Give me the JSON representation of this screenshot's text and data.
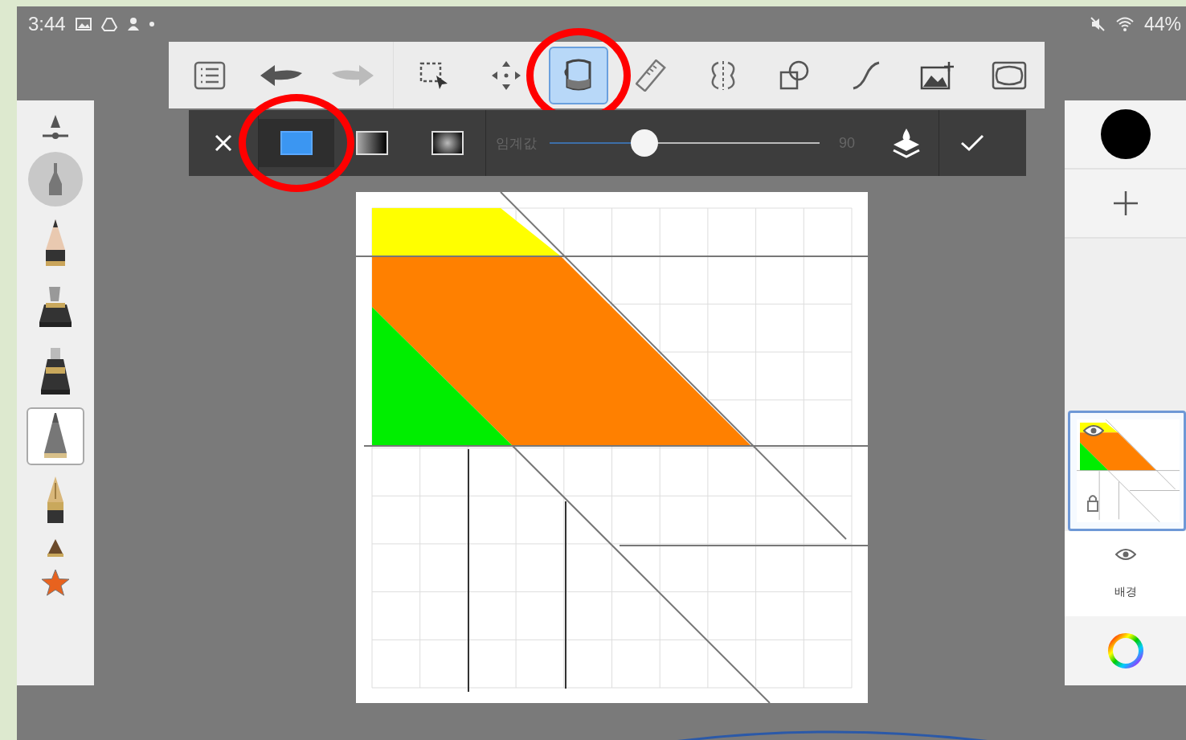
{
  "status_bar": {
    "time": "3:44",
    "battery": "44%"
  },
  "toolbar": {
    "tools": [
      {
        "kind": "list",
        "selected": false,
        "circled": false
      },
      {
        "kind": "undo",
        "selected": false,
        "circled": false
      },
      {
        "kind": "redo",
        "selected": false,
        "circled": false
      },
      {
        "kind": "select",
        "selected": false,
        "circled": false
      },
      {
        "kind": "move",
        "selected": false,
        "circled": false
      },
      {
        "kind": "fill",
        "selected": true,
        "circled": true
      },
      {
        "kind": "ruler",
        "selected": false,
        "circled": false
      },
      {
        "kind": "symmetry",
        "selected": false,
        "circled": false
      },
      {
        "kind": "shapes",
        "selected": false,
        "circled": false
      },
      {
        "kind": "curve",
        "selected": false,
        "circled": false
      },
      {
        "kind": "image",
        "selected": false,
        "circled": false
      },
      {
        "kind": "frame",
        "selected": false,
        "circled": false
      }
    ]
  },
  "fill_options": {
    "modes": [
      {
        "kind": "solid",
        "selected": true,
        "circled": true
      },
      {
        "kind": "linear",
        "selected": false,
        "circled": false
      },
      {
        "kind": "radial",
        "selected": false,
        "circled": false
      }
    ],
    "threshold": {
      "label": "임계값",
      "level": 0.35,
      "reading": "90"
    }
  },
  "brushes": [
    {
      "kind": "airbrush",
      "selected": false
    },
    {
      "kind": "pencil",
      "selected": false
    },
    {
      "kind": "marker",
      "selected": false
    },
    {
      "kind": "ink",
      "selected": false
    },
    {
      "kind": "pen",
      "selected": true
    },
    {
      "kind": "nib",
      "selected": false
    },
    {
      "kind": "small",
      "selected": false
    },
    {
      "kind": "star",
      "selected": false
    }
  ],
  "layers": [
    {
      "kind": "drawing",
      "selected": true,
      "visible": true
    },
    {
      "kind": "background",
      "name": "배경",
      "selected": false,
      "visible": true
    }
  ]
}
